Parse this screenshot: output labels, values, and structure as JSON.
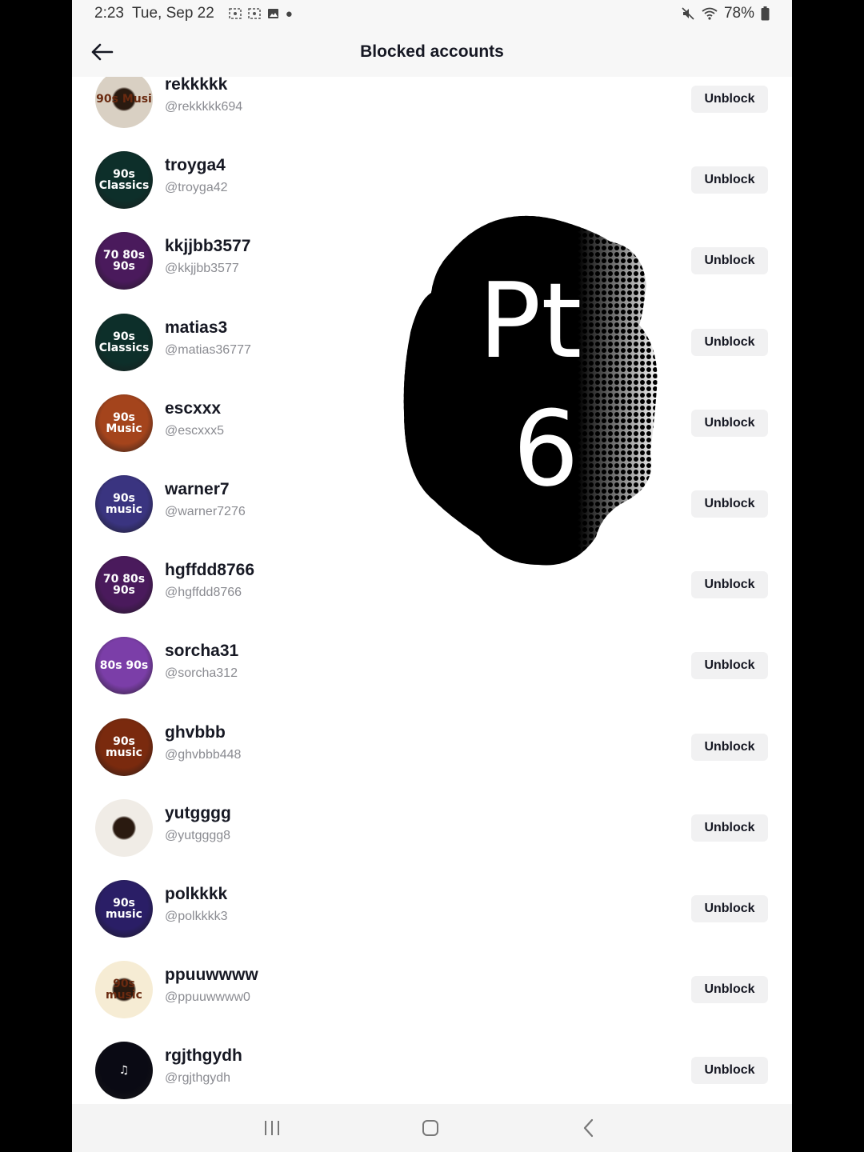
{
  "status_bar": {
    "time": "2:23",
    "date": "Tue, Sep 22",
    "battery": "78%",
    "icons": [
      "screenshot-icon",
      "screenshot-icon",
      "image-icon",
      "dot-icon",
      "mute-icon",
      "wifi-icon",
      "battery-icon"
    ]
  },
  "header": {
    "title": "Blocked accounts",
    "back_icon": "arrow-left-icon"
  },
  "accounts": [
    {
      "name": "rekkkkk",
      "handle": "@rekkkkk694",
      "button": "Unblock",
      "avatar_color": "#d9d0c3",
      "avatar_text": "90s Musi"
    },
    {
      "name": "troyga4",
      "handle": "@troyga42",
      "button": "Unblock",
      "avatar_color": "#0d2f2a",
      "avatar_text": "90s Classics"
    },
    {
      "name": "kkjjbb3577",
      "handle": "@kkjjbb3577",
      "button": "Unblock",
      "avatar_color": "#4a1a5c",
      "avatar_text": "70 80s 90s"
    },
    {
      "name": "matias3",
      "handle": "@matias36777",
      "button": "Unblock",
      "avatar_color": "#0d2f2a",
      "avatar_text": "90s Classics"
    },
    {
      "name": "escxxx",
      "handle": "@escxxx5",
      "button": "Unblock",
      "avatar_color": "#a4441c",
      "avatar_text": "90s Music"
    },
    {
      "name": "warner7",
      "handle": "@warner7276",
      "button": "Unblock",
      "avatar_color": "#3a3480",
      "avatar_text": "90s music"
    },
    {
      "name": "hgffdd8766",
      "handle": "@hgffdd8766",
      "button": "Unblock",
      "avatar_color": "#4a1a5c",
      "avatar_text": "70 80s 90s"
    },
    {
      "name": "sorcha31",
      "handle": "@sorcha312",
      "button": "Unblock",
      "avatar_color": "#7b3ea8",
      "avatar_text": "80s 90s"
    },
    {
      "name": "ghvbbb",
      "handle": "@ghvbbb448",
      "button": "Unblock",
      "avatar_color": "#7a2a0e",
      "avatar_text": "90s music"
    },
    {
      "name": "yutgggg",
      "handle": "@yutgggg8",
      "button": "Unblock",
      "avatar_color": "#f0ece6",
      "avatar_text": ""
    },
    {
      "name": "polkkkk",
      "handle": "@polkkkk3",
      "button": "Unblock",
      "avatar_color": "#2a1e66",
      "avatar_text": "90s music"
    },
    {
      "name": "ppuuwwww",
      "handle": "@ppuuwwww0",
      "button": "Unblock",
      "avatar_color": "#f6ecd4",
      "avatar_text": "90s music"
    },
    {
      "name": "rgjthgydh",
      "handle": "@rgjthgydh",
      "button": "Unblock",
      "avatar_color": "#0a0a14",
      "avatar_text": "♫"
    }
  ],
  "overlay": {
    "line1": "Pt",
    "line2": "6"
  },
  "nav_bar": {
    "icons": [
      "recent-apps-icon",
      "home-icon",
      "back-chevron-icon"
    ]
  }
}
